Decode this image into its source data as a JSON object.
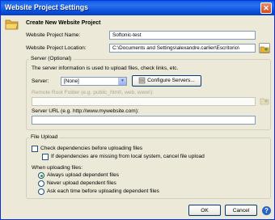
{
  "window": {
    "title": "Website Project Settings",
    "close_glyph": "✕"
  },
  "header": {
    "title": "Create New Website Project",
    "icon": "folder-icon"
  },
  "project": {
    "name_label": "Website Project Name:",
    "name_value": "Softonic-test",
    "location_label": "Website Project Location:",
    "location_value": "C:\\Documents and Settings\\alexandre.carlier\\Escritorio\\",
    "browse_icon": "folder-browse-icon"
  },
  "server": {
    "group_label": "Server (Optional)",
    "info_text": "The server information is used to upload files, check links, etc.",
    "server_label": "Server:",
    "server_selected": "[None]",
    "configure_label": "Configure Servers...",
    "remote_root_label": "Remote Root Folder (e.g. public_html\\, web, www\\):",
    "remote_root_value": "",
    "url_label": "Server URL (e.g. http://www.mywebsite.com):",
    "url_value": ""
  },
  "file_upload": {
    "group_label": "File Upload",
    "check_deps_label": "Check dependencies before uploading files",
    "check_deps_checked": false,
    "missing_label": "If dependencies are missing from local system, cancel file upload",
    "missing_checked": false,
    "when_label": "When uploading files:",
    "options": [
      {
        "label": "Always upload dependent files",
        "selected": true
      },
      {
        "label": "Never upload dependent files",
        "selected": false
      },
      {
        "label": "Ask each time before uploading dependent files",
        "selected": false
      }
    ]
  },
  "footer": {
    "ok_label": "OK",
    "cancel_label": "Cancel"
  },
  "colors": {
    "titlebar": "#0a5ee4",
    "dialog_bg": "#ece9d8",
    "border": "#7f9db9"
  }
}
